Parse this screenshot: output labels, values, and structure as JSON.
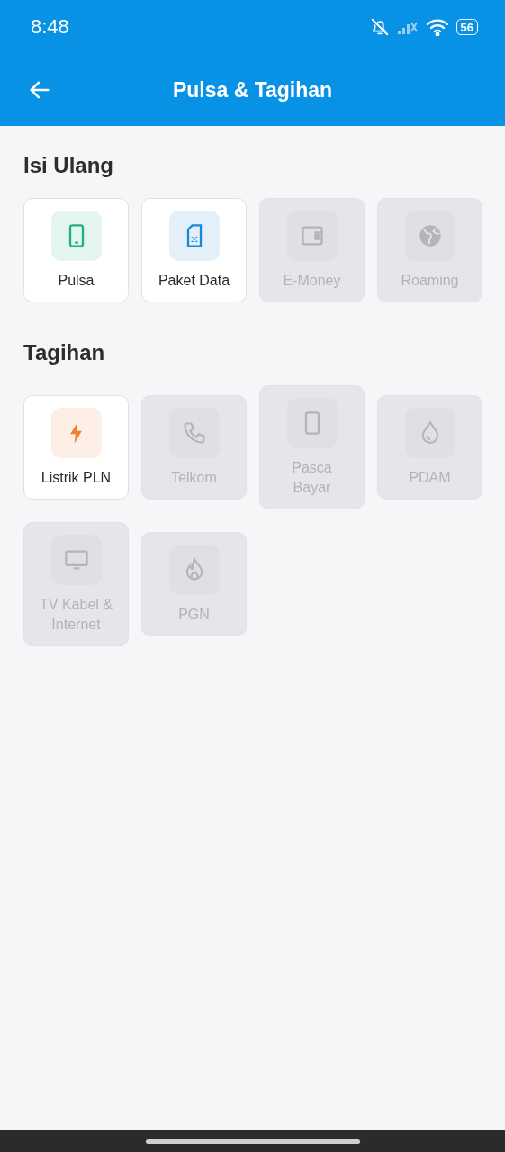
{
  "status_bar": {
    "time": "8:48",
    "battery": "56"
  },
  "app_bar": {
    "title": "Pulsa & Tagihan"
  },
  "sections": [
    {
      "title": "Isi Ulang",
      "items": [
        {
          "label": "Pulsa",
          "kind": "phone",
          "disabled": false,
          "color": "#22b07d"
        },
        {
          "label": "Paket Data",
          "kind": "sim",
          "disabled": false,
          "color": "#1a86d6"
        },
        {
          "label": "E-Money",
          "kind": "wallet",
          "disabled": true
        },
        {
          "label": "Roaming",
          "kind": "globe",
          "disabled": true
        }
      ]
    },
    {
      "title": "Tagihan",
      "items": [
        {
          "label": "Listrik PLN",
          "kind": "bolt",
          "disabled": false,
          "color": "#f07f2c"
        },
        {
          "label": "Telkom",
          "kind": "telephone",
          "disabled": true
        },
        {
          "label": "Pasca Bayar",
          "kind": "phone",
          "disabled": true
        },
        {
          "label": "PDAM",
          "kind": "drop",
          "disabled": true
        },
        {
          "label": "TV Kabel & Internet",
          "kind": "tv",
          "disabled": true
        },
        {
          "label": "PGN",
          "kind": "flame",
          "disabled": true
        }
      ]
    }
  ]
}
